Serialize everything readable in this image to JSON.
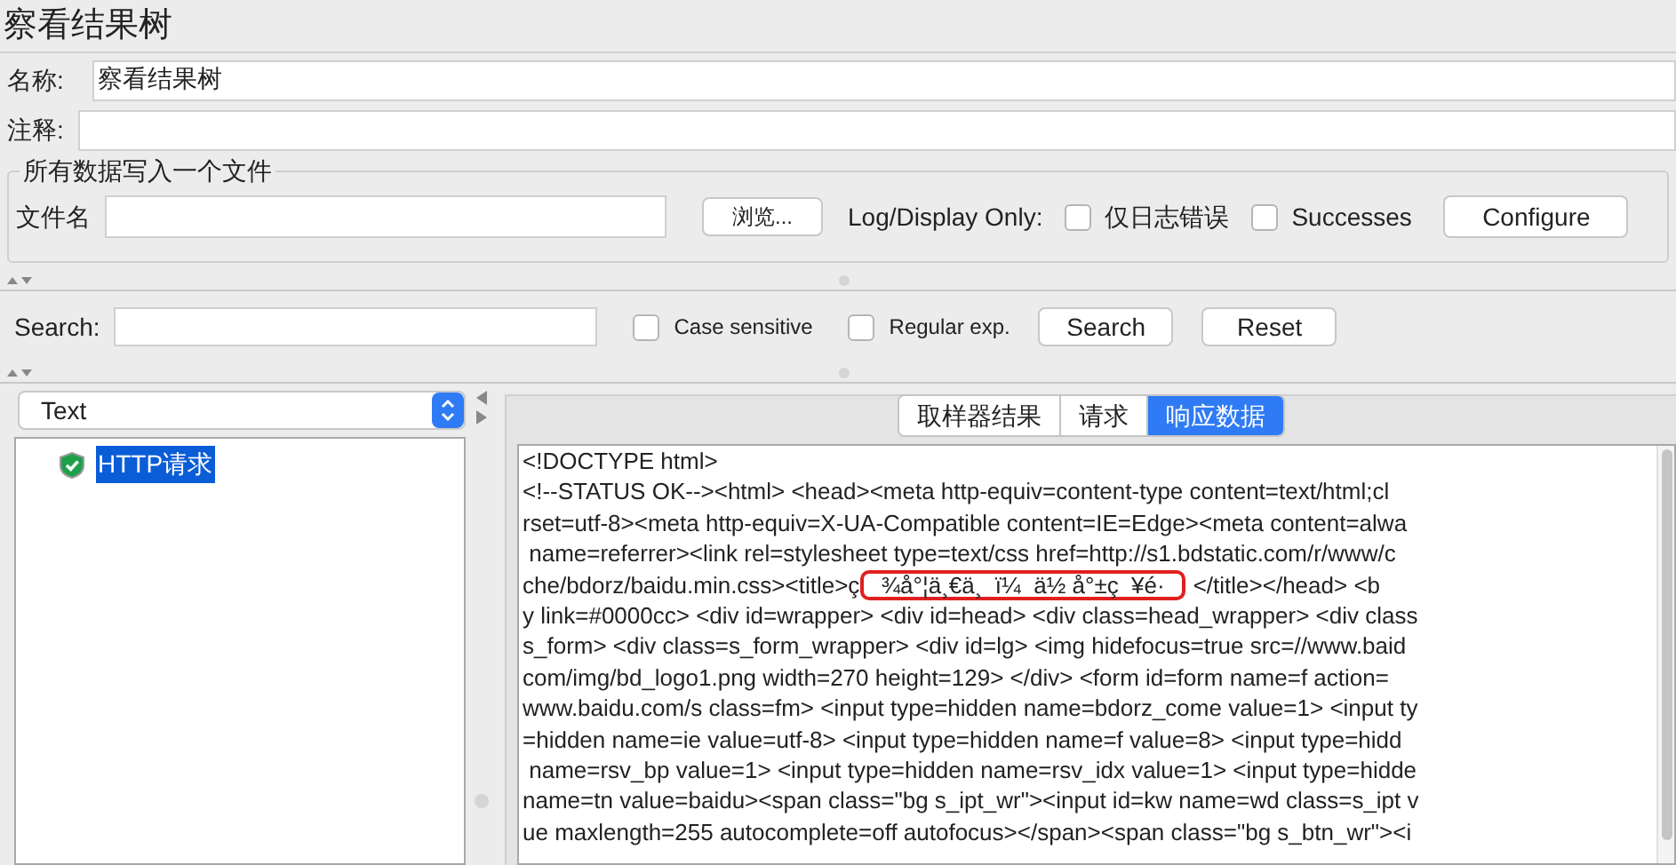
{
  "window": {
    "title": "察看结果树"
  },
  "name_field": {
    "label": "名称:",
    "value": "察看结果树"
  },
  "comment_field": {
    "label": "注释:"
  },
  "file_group": {
    "legend": "所有数据写入一个文件",
    "filename_label": "文件名",
    "browse_button": "浏览...",
    "log_label": "Log/Display Only:",
    "checkboxes": [
      {
        "label": "仅日志错误",
        "checked": false
      },
      {
        "label": "Successes",
        "checked": false
      }
    ],
    "configure_button": "Configure"
  },
  "search": {
    "label": "Search:",
    "checkboxes": [
      {
        "label": "Case sensitive",
        "checked": false
      },
      {
        "label": "Regular exp.",
        "checked": false
      }
    ],
    "buttons": [
      "Search",
      "Reset"
    ]
  },
  "renderer_select": {
    "value": "Text"
  },
  "tree": [
    {
      "label": "HTTP请求",
      "selected": true
    }
  ],
  "tabs": [
    {
      "label": "取样器结果",
      "selected": false
    },
    {
      "label": "请求",
      "selected": false
    },
    {
      "label": "响应数据",
      "selected": true
    }
  ],
  "response_lines": [
    {
      "text": "<!DOCTYPE html>"
    },
    {
      "text": "<!--STATUS OK--><html> <head><meta http-equiv=content-type content=text/html;cl"
    },
    {
      "text": "rset=utf-8><meta http-equiv=X-UA-Compatible content=IE=Edge><meta content=alwa"
    },
    {
      "text": " name=referrer><link rel=stylesheet type=text/css href=http://s1.bdstatic.com/r/www/c"
    },
    {
      "text": "che/bdorz/baidu.min.css><title>ç",
      "highlight": "¾å°¦ä¸€ä¸  ï¼  ä½ å°±ç  ¥é·",
      "after": "</title></head> <b"
    },
    {
      "text": "y link=#0000cc> <div id=wrapper> <div id=head> <div class=head_wrapper> <div class"
    },
    {
      "text": "s_form> <div class=s_form_wrapper> <div id=lg> <img hidefocus=true src=//www.baid"
    },
    {
      "text": "com/img/bd_logo1.png width=270 height=129> </div> <form id=form name=f action="
    },
    {
      "text": "www.baidu.com/s class=fm> <input type=hidden name=bdorz_come value=1> <input ty"
    },
    {
      "text": "=hidden name=ie value=utf-8> <input type=hidden name=f value=8> <input type=hidd"
    },
    {
      "text": " name=rsv_bp value=1> <input type=hidden name=rsv_idx value=1> <input type=hidde"
    },
    {
      "text": "name=tn value=baidu><span class=\"bg s_ipt_wr\"><input id=kw name=wd class=s_ipt v"
    },
    {
      "text": "ue maxlength=255 autocomplete=off autofocus></span><span class=\"bg s_btn_wr\"><i"
    }
  ]
}
